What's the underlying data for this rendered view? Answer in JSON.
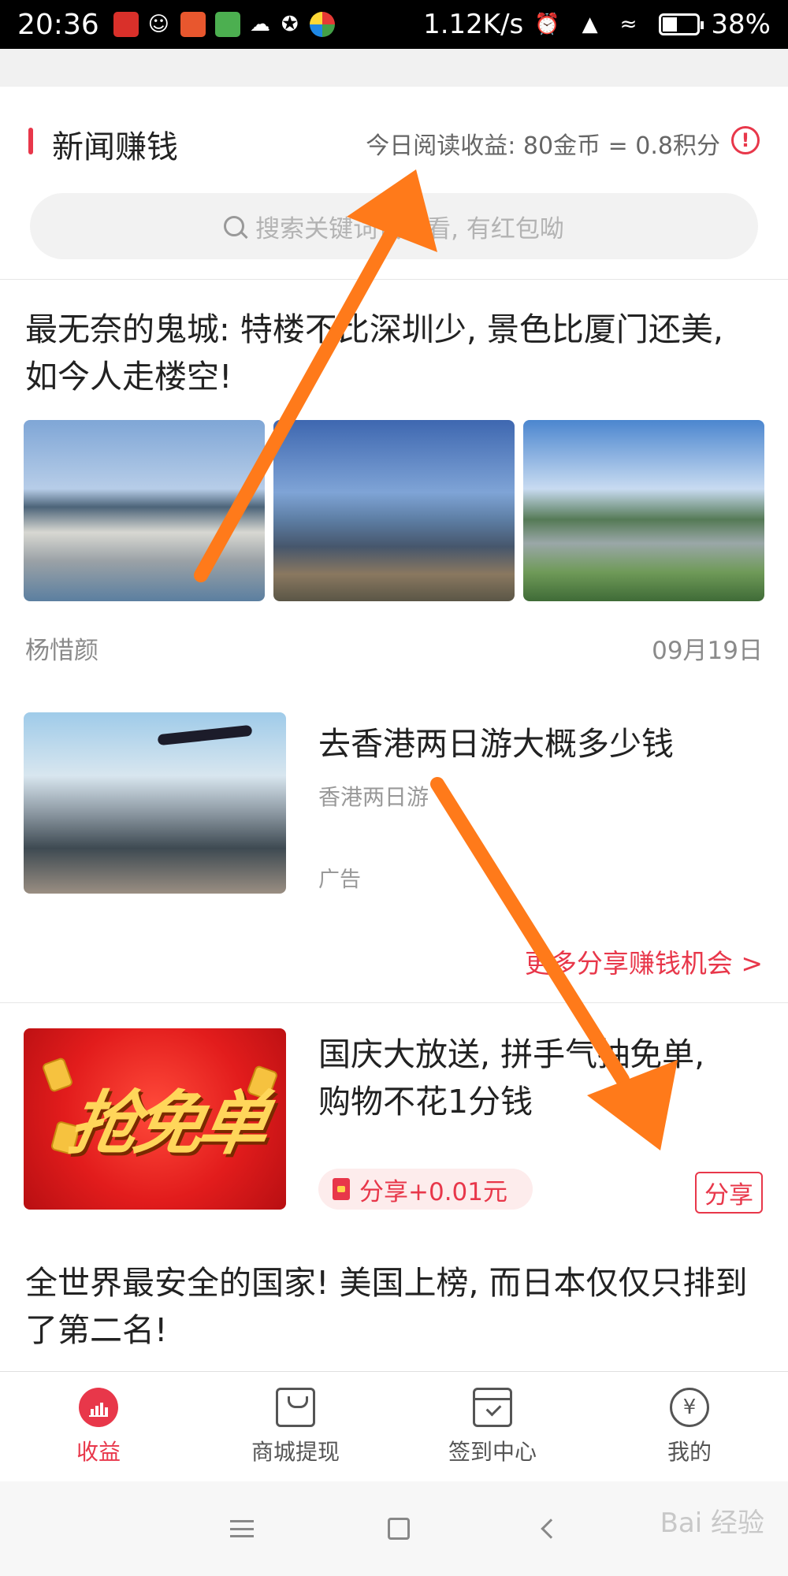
{
  "status_bar": {
    "time": "20:36",
    "speed": "1.12K/s",
    "battery": "38%",
    "battery_level": 0.38,
    "icons": [
      "money-locker-app-icon",
      "qq-icon",
      "app-icon",
      "app-icon",
      "cloud-icon",
      "app-icon",
      "app-icon",
      "alarm-icon",
      "signal-icon",
      "wifi-icon",
      "battery-icon"
    ]
  },
  "header": {
    "title": "新闻赚钱",
    "earnings": "今日阅读收益: 80金币 = 0.8积分",
    "info_icon": "!",
    "search_placeholder": "搜索关键词试试看, 有红包呦"
  },
  "articles": [
    {
      "title": "最无奈的鬼城: 特楼不比深圳少, 景色比厦门还美, 如今人走楼空!",
      "author": "杨惜颜",
      "date": "09月19日"
    }
  ],
  "ad": {
    "title": "去香港两日游大概多少钱",
    "subtitle": "香港两日游",
    "label": "广告",
    "more_link": "更多分享赚钱机会 >"
  },
  "promo": {
    "image_text": "抢免单",
    "title": "国庆大放送, 拼手气抽免单, 购物不花1分钱",
    "share_reward": "分享+0.01元",
    "share_button": "分享"
  },
  "article3": {
    "title": "全世界最安全的国家! 美国上榜, 而日本仅仅只排到了第二名!"
  },
  "tabs": [
    {
      "label": "收益",
      "icon": "chart-icon",
      "active": true
    },
    {
      "label": "商城提现",
      "icon": "bag-icon",
      "active": false
    },
    {
      "label": "签到中心",
      "icon": "calendar-icon",
      "active": false
    },
    {
      "label": "我的",
      "icon": "yen-icon",
      "active": false
    }
  ],
  "watermark": "Bai 经验",
  "colors": {
    "accent": "#e8374a",
    "annotation_arrow": "#ff7a1a"
  }
}
